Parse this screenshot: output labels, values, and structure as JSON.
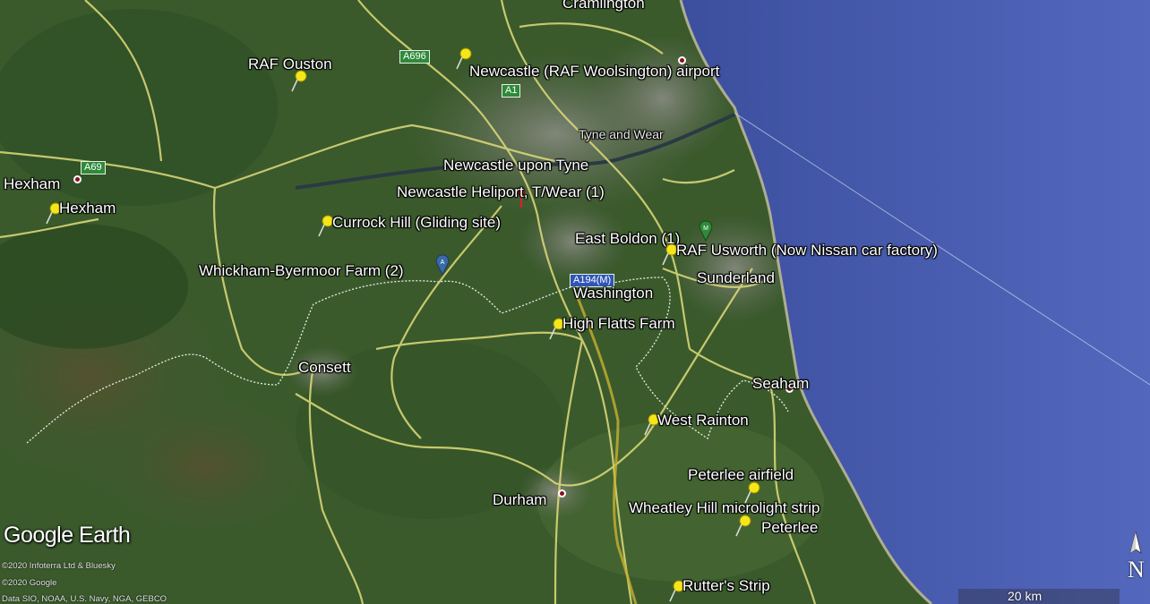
{
  "brand": {
    "name": "Google Earth"
  },
  "credits": [
    "©2020 Infoterra Ltd & Bluesky",
    "©2020 Google",
    "Data SIO, NOAA, U.S. Navy, NGA, GEBCO"
  ],
  "scale": {
    "label": "20 km"
  },
  "north": {
    "letter": "N"
  },
  "region_label": "Tyne and Wear",
  "road_shields": {
    "a696": "A696",
    "a1": "A1",
    "a69": "A69",
    "a194m": "A194(M)"
  },
  "places": {
    "cramlington": "Cramlington",
    "newcastle_upon_tyne": "Newcastle upon Tyne",
    "hexham_town": "Hexham",
    "washington": "Washington",
    "sunderland": "Sunderland",
    "consett": "Consett",
    "seaham": "Seaham",
    "durham": "Durham",
    "peterlee": "Peterlee"
  },
  "markers": {
    "raf_ouston": "RAF Ouston",
    "newcastle_airport": "Newcastle (RAF Woolsington) airport",
    "newcastle_heliport": "Newcastle Heliport, T/Wear (1)",
    "hexham": "Hexham",
    "currock_hill": "Currock Hill (Gliding site)",
    "whickham_byermoor": "Whickham-Byermoor Farm (2)",
    "east_boldon": "East Boldon (1)",
    "raf_usworth": "RAF Usworth  (Now Nissan car factory)",
    "high_flatts": "High Flatts Farm",
    "west_rainton": "West Rainton",
    "peterlee_airfield": "Peterlee airfield",
    "wheatley_hill": "Wheatley Hill microlight strip",
    "rutters_strip": "Rutter's Strip"
  },
  "colors": {
    "sea": "#4a5fb0",
    "land": "#3b5a2e",
    "roads": "#e0dc7a",
    "pin": "#f5e61a",
    "boundary": "#ffffff"
  }
}
